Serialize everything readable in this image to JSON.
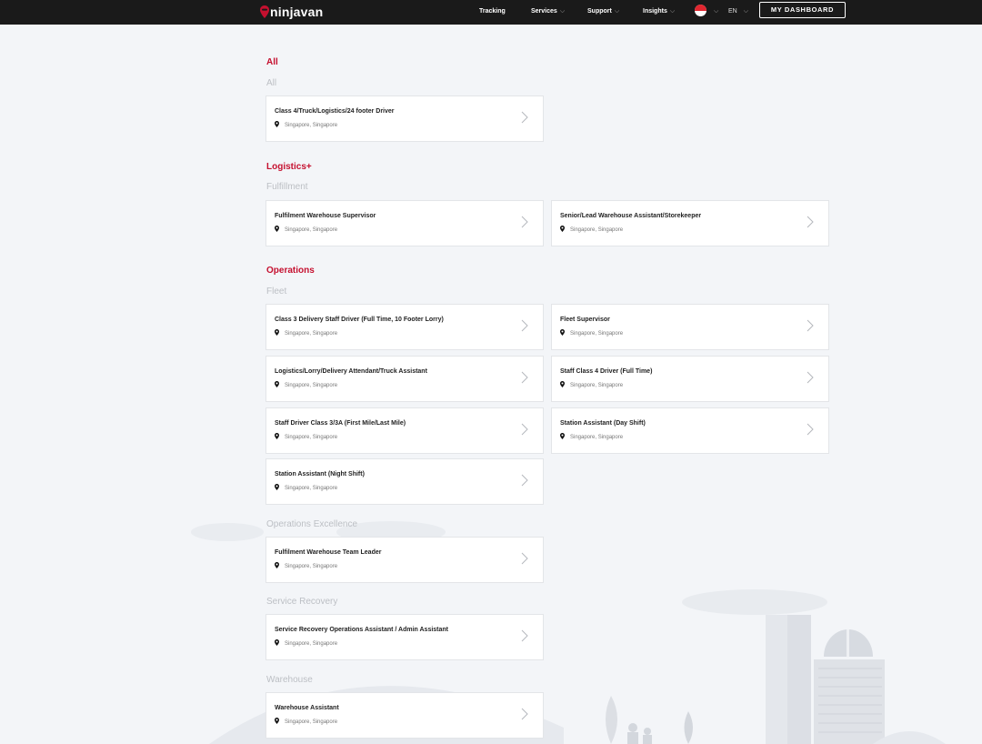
{
  "header": {
    "logo_text": "ninjavan",
    "nav": [
      {
        "label": "Tracking"
      },
      {
        "label": "Services"
      },
      {
        "label": "Support"
      },
      {
        "label": "Insights"
      }
    ],
    "language": "EN",
    "dashboard_label": "MY DASHBOARD",
    "chevron": "⌵"
  },
  "sections": [
    {
      "title": "All",
      "subsections": [
        {
          "title": "All",
          "jobs": [
            {
              "title": "Class 4/Truck/Logistics/24 footer Driver",
              "location": "Singapore, Singapore"
            }
          ]
        }
      ]
    },
    {
      "title": "Logistics+",
      "subsections": [
        {
          "title": "Fulfillment",
          "jobs": [
            {
              "title": "Fulfilment Warehouse Supervisor",
              "location": "Singapore, Singapore"
            },
            {
              "title": "Senior/Lead Warehouse Assistant/Storekeeper",
              "location": "Singapore, Singapore"
            }
          ]
        }
      ]
    },
    {
      "title": "Operations",
      "subsections": [
        {
          "title": "Fleet",
          "jobs": [
            {
              "title": "Class 3 Delivery Staff Driver (Full Time, 10 Footer Lorry)",
              "location": "Singapore, Singapore"
            },
            {
              "title": "Fleet Supervisor",
              "location": "Singapore, Singapore"
            },
            {
              "title": "Logistics/Lorry/Delivery Attendant/Truck Assistant",
              "location": "Singapore, Singapore"
            },
            {
              "title": "Staff Class 4 Driver (Full Time)",
              "location": "Singapore, Singapore"
            },
            {
              "title": "Staff Driver Class 3/3A (First Mile/Last Mile)",
              "location": "Singapore, Singapore"
            },
            {
              "title": "Station Assistant (Day Shift)",
              "location": "Singapore, Singapore"
            },
            {
              "title": "Station Assistant (Night Shift)",
              "location": "Singapore, Singapore"
            }
          ]
        },
        {
          "title": "Operations Excellence",
          "jobs": [
            {
              "title": "Fulfilment Warehouse Team Leader",
              "location": "Singapore, Singapore"
            }
          ]
        },
        {
          "title": "Service Recovery",
          "jobs": [
            {
              "title": "Service Recovery Operations Assistant / Admin Assistant",
              "location": "Singapore, Singapore"
            }
          ]
        },
        {
          "title": "Warehouse",
          "jobs": [
            {
              "title": "Warehouse Assistant",
              "location": "Singapore, Singapore"
            }
          ]
        }
      ]
    }
  ],
  "icons": {
    "logo": "ninja-pin-icon",
    "flag": "singapore-flag-icon",
    "location": "location-pin-icon",
    "card_arrow": "chevron-right-icon"
  },
  "colors": {
    "brand_red": "#c5102f",
    "topbar": "#1a1a1a",
    "page_bg": "#f3f5f8",
    "subsection_gray": "#bcbfc4"
  }
}
